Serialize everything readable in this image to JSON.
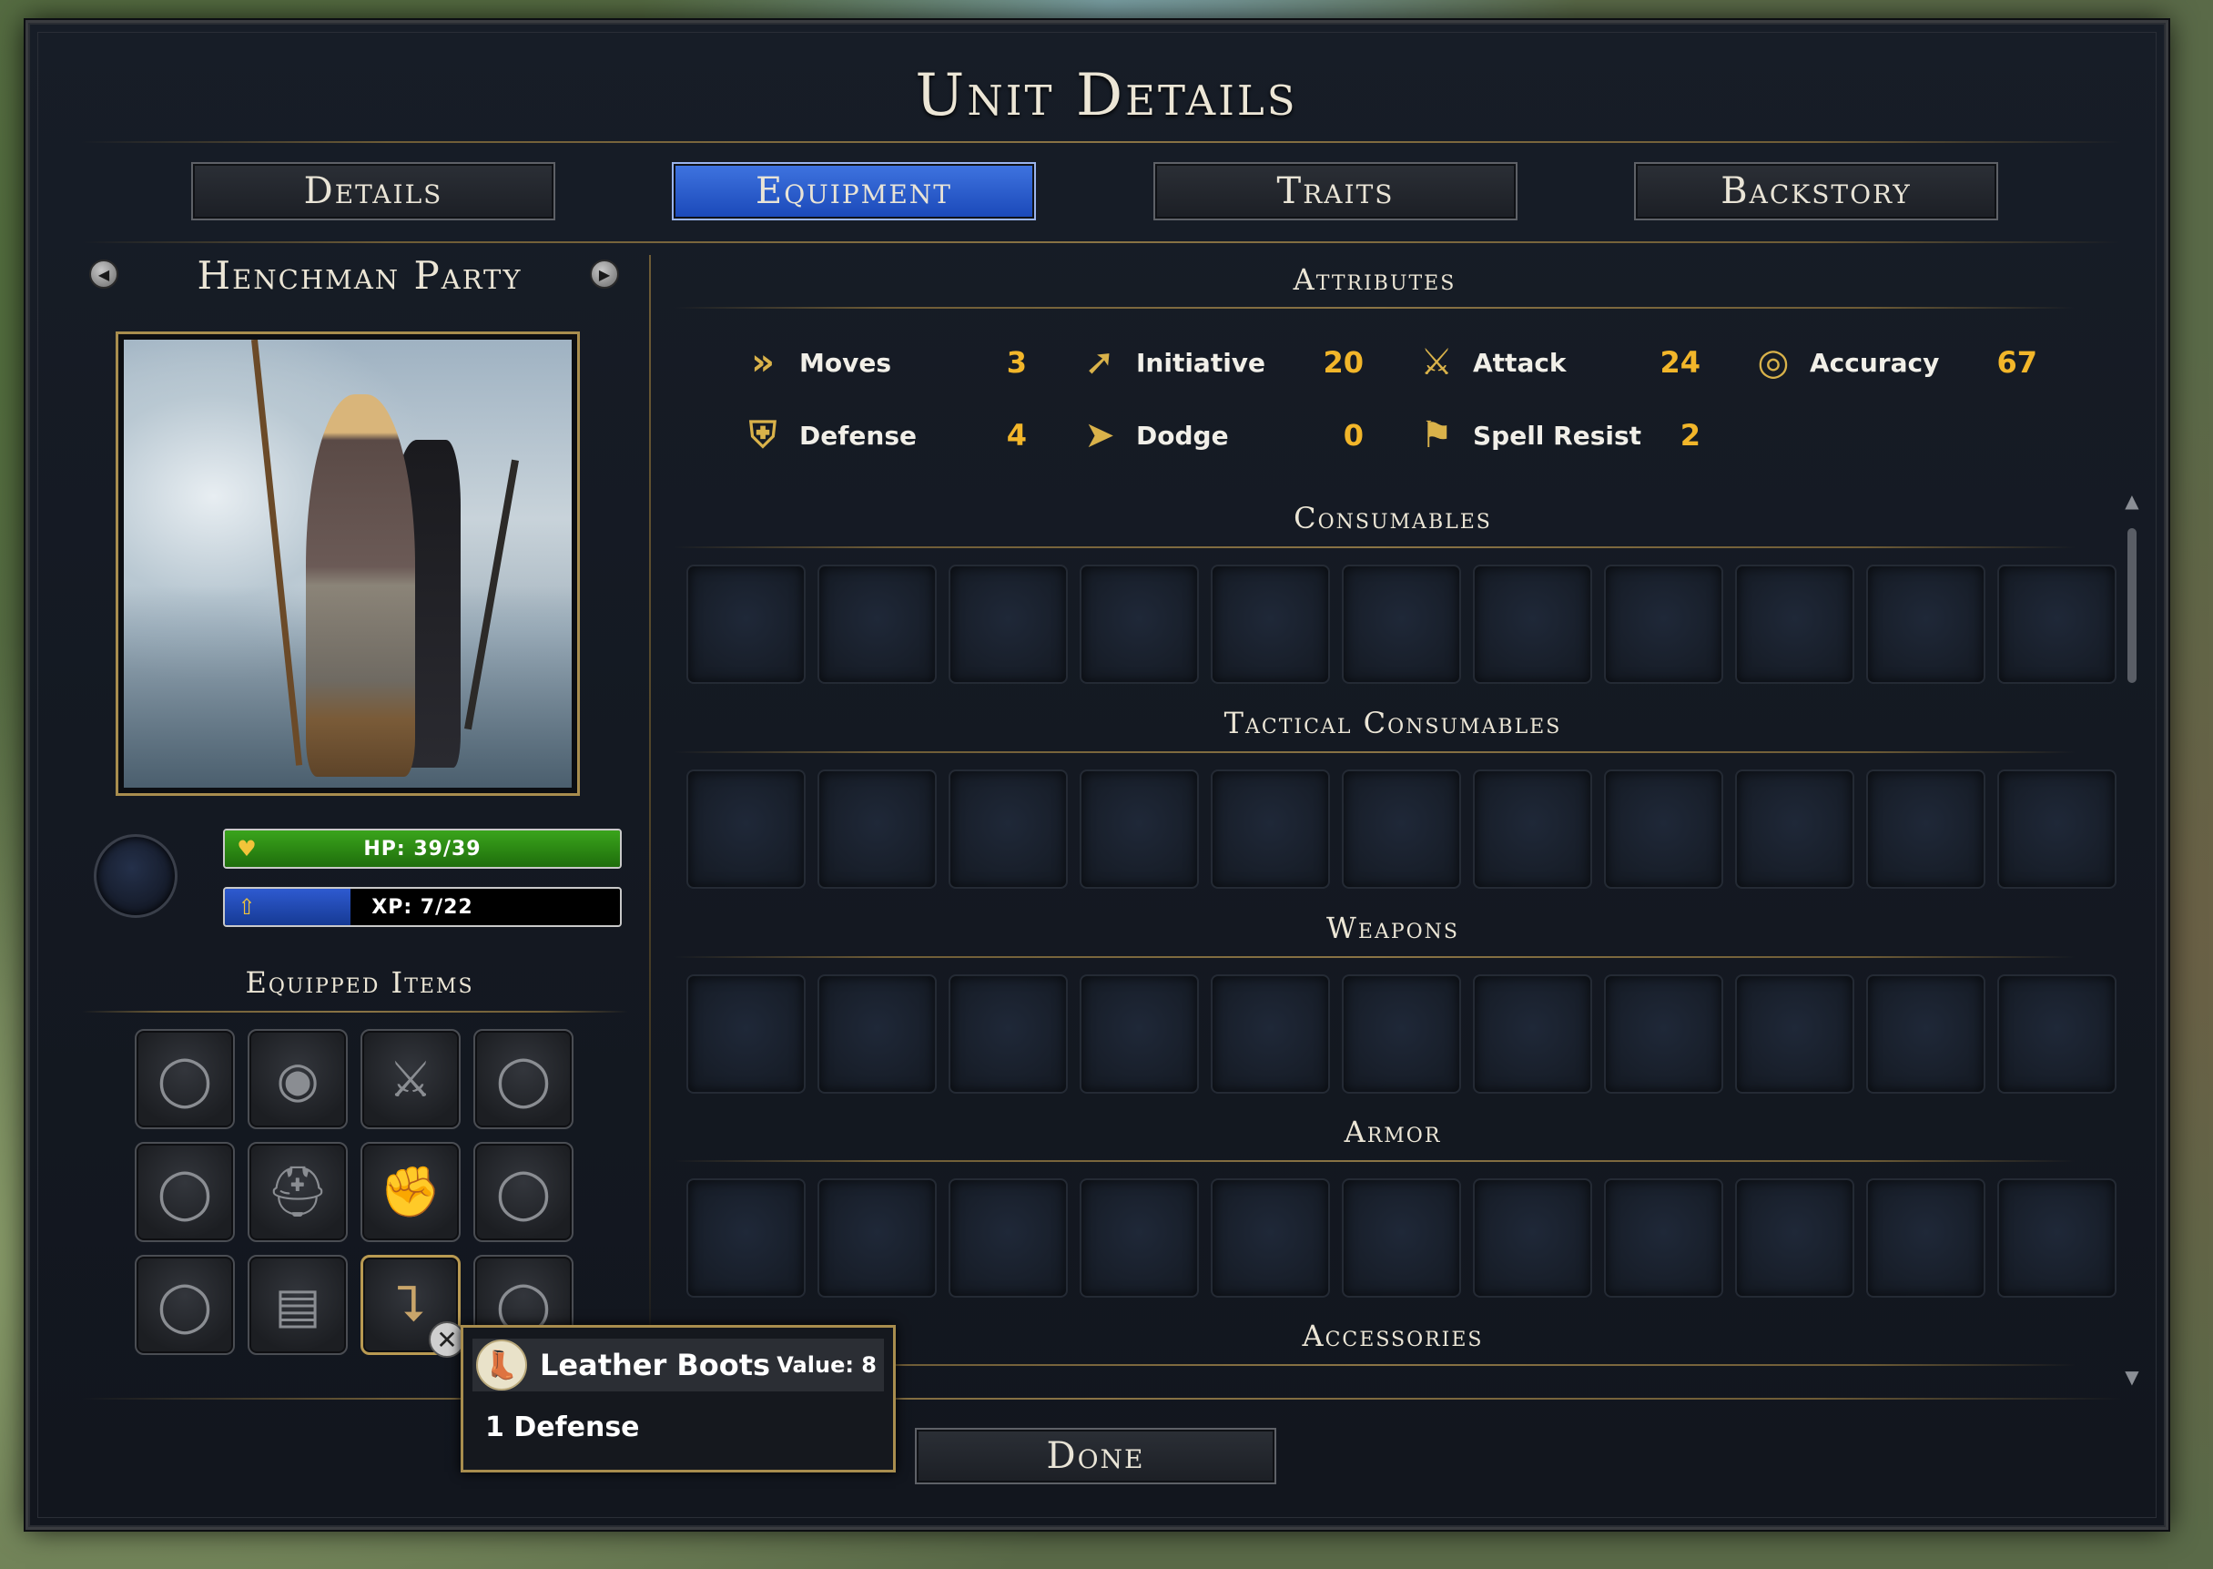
{
  "window": {
    "title": "Unit Details"
  },
  "tabs": [
    {
      "label": "Details",
      "active": false
    },
    {
      "label": "Equipment",
      "active": true
    },
    {
      "label": "Traits",
      "active": false
    },
    {
      "label": "Backstory",
      "active": false
    }
  ],
  "unit": {
    "name": "Henchman Party",
    "hp_text": "HP: 39/39",
    "hp_fraction": 1.0,
    "xp_text": "XP: 7/22",
    "xp_fraction": 0.318
  },
  "equipped": {
    "title": "Equipped Items",
    "slots": [
      {
        "icon": "ring-icon"
      },
      {
        "icon": "shield-icon"
      },
      {
        "icon": "sword-icon"
      },
      {
        "icon": "ring-icon"
      },
      {
        "icon": "ring-icon"
      },
      {
        "icon": "helmet-icon"
      },
      {
        "icon": "gauntlet-icon"
      },
      {
        "icon": "ring-icon"
      },
      {
        "icon": "ring-icon"
      },
      {
        "icon": "chest-armor-icon"
      },
      {
        "icon": "boots-icon",
        "selected": true
      },
      {
        "icon": "ring-icon"
      }
    ]
  },
  "attributes": {
    "title": "Attributes",
    "items": [
      {
        "label": "Moves",
        "value": "3",
        "icon": "moves-icon"
      },
      {
        "label": "Initiative",
        "value": "20",
        "icon": "initiative-icon"
      },
      {
        "label": "Attack",
        "value": "24",
        "icon": "attack-icon"
      },
      {
        "label": "Accuracy",
        "value": "67",
        "icon": "accuracy-icon"
      },
      {
        "label": "Defense",
        "value": "4",
        "icon": "defense-icon"
      },
      {
        "label": "Dodge",
        "value": "0",
        "icon": "dodge-icon"
      },
      {
        "label": "Spell Resist",
        "value": "2",
        "icon": "spell-resist-icon"
      }
    ]
  },
  "sections": [
    {
      "title": "Consumables"
    },
    {
      "title": "Tactical Consumables"
    },
    {
      "title": "Weapons"
    },
    {
      "title": "Armor"
    },
    {
      "title": "Accessories"
    }
  ],
  "tooltip": {
    "name": "Leather Boots",
    "value": "Value: 8",
    "effect": "1 Defense"
  },
  "done_label": "Done",
  "colors": {
    "accent_gold": "#a88d4e",
    "value_orange": "#f2b62a",
    "active_tab": "#2a5ed0",
    "hp_green": "#2f8a16",
    "xp_blue": "#1e3f9a"
  }
}
